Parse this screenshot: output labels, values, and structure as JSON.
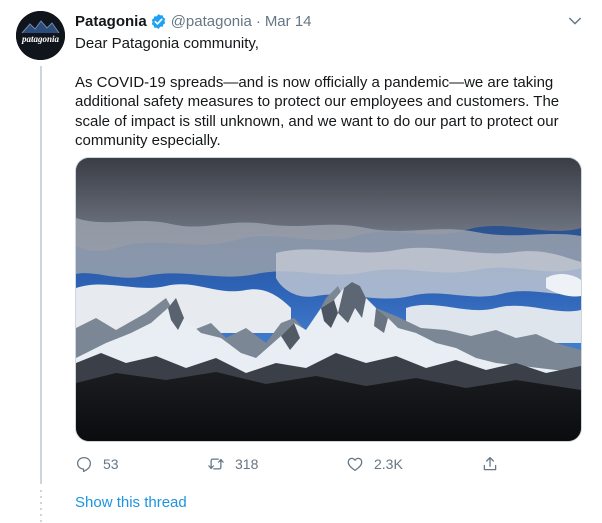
{
  "tweet": {
    "author_name": "Patagonia",
    "author_handle": "@patagonia",
    "separator": "·",
    "date": "Mar 14",
    "avatar_text": "patagonia",
    "paragraphs": [
      "Dear Patagonia community,",
      "As COVID-19 spreads—and is now officially a pandemic—we are taking additional safety measures to protect our employees and customers. The scale of impact is still unknown, and we want to do our part to protect our community especially."
    ],
    "media_icon": "mountain-landscape-photo",
    "actions": {
      "reply_count": "53",
      "retweet_count": "318",
      "like_count": "2.3K"
    },
    "show_thread": "Show this thread"
  },
  "icons": [
    "verified-badge-icon",
    "chevron-down-icon",
    "reply-icon",
    "retweet-icon",
    "like-icon",
    "share-icon"
  ],
  "colors": {
    "link": "#1b95e0",
    "verified": "#1da1f2",
    "muted": "#657786",
    "text": "#14171a",
    "avatar_bg": "#10151c"
  }
}
